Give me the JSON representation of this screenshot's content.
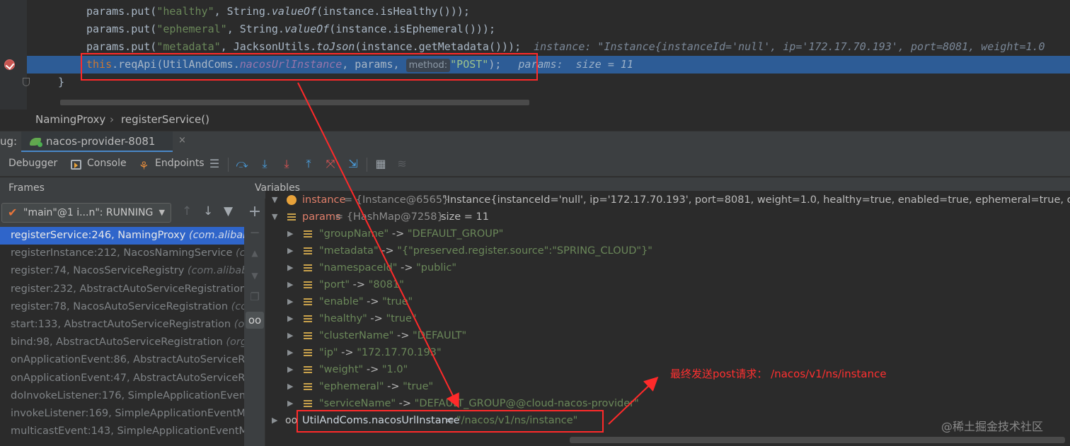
{
  "editor": {
    "lines": [
      {
        "a": "params.put(",
        "s": "\"healthy\"",
        "b": ", String.",
        "m": "valueOf",
        "c": "(instance.isHealthy()));"
      },
      {
        "a": "params.put(",
        "s": "\"ephemeral\"",
        "b": ", String.",
        "m": "valueOf",
        "c": "(instance.isEphemeral()));"
      },
      {
        "a": "params.put(",
        "s": "\"metadata\"",
        "b": ", JacksonUtils.",
        "m": "toJson",
        "c": "(instance.getMetadata()));",
        "inlay": "instance: \"Instance{instanceId='null', ip='172.17.70.193', port=8081, weight=1.0"
      }
    ],
    "current_line": {
      "kw": "this",
      "a": ".reqApi(UtilAndComs.",
      "field": "nacosUrlInstance",
      "b": ", params, ",
      "hint": "method:",
      "str": "\"POST\"",
      "end": ");",
      "inlay": "params:  size = 11"
    },
    "closing_brace": "}"
  },
  "breadcrumb": {
    "class_name": "NamingProxy",
    "separator": "›",
    "method_name": "registerService()"
  },
  "debug_tabbar": {
    "label": "ug:",
    "run_name": "nacos-provider-8081",
    "close": "×"
  },
  "toolbar": {
    "debugger": "Debugger",
    "console": "Console",
    "endpoints": "Endpoints"
  },
  "frames": {
    "header": "Frames",
    "thread": "\"main\"@1 i...n\": RUNNING",
    "items": [
      {
        "method": "registerService:246, NamingProxy ",
        "pkg": "(com.alibaba"
      },
      {
        "method": "registerInstance:212, NacosNamingService ",
        "pkg": "(co"
      },
      {
        "method": "register:74, NacosServiceRegistry ",
        "pkg": "(com.alibaba"
      },
      {
        "method": "register:232, AbstractAutoServiceRegistration",
        "pkg": ""
      },
      {
        "method": "register:78, NacosAutoServiceRegistration ",
        "pkg": "(co"
      },
      {
        "method": "start:133, AbstractAutoServiceRegistration ",
        "pkg": "(org"
      },
      {
        "method": "bind:98, AbstractAutoServiceRegistration ",
        "pkg": "(org."
      },
      {
        "method": "onApplicationEvent:86, AbstractAutoServiceRe",
        "pkg": ""
      },
      {
        "method": "onApplicationEvent:47, AbstractAutoServiceRe",
        "pkg": ""
      },
      {
        "method": "doInvokeListener:176, SimpleApplicationEventM",
        "pkg": ""
      },
      {
        "method": "invokeListener:169, SimpleApplicationEventMu",
        "pkg": ""
      },
      {
        "method": "multicastEvent:143, SimpleApplicationEventMu",
        "pkg": ""
      }
    ]
  },
  "variables": {
    "header": "Variables",
    "instance_row": {
      "name": "instance",
      "ref": " = {Instance@6565} ",
      "value": "\"Instance{instanceId='null', ip='172.17.70.193', port=8081, weight=1.0, healthy=true, enabled=true, ephemeral=true, clusterNa"
    },
    "params_row": {
      "name": "params",
      "ref": " = {HashMap@7258} ",
      "value": " size = 11"
    },
    "entries": [
      {
        "key": "\"groupName\"",
        "value": "\"DEFAULT_GROUP\""
      },
      {
        "key": "\"metadata\"",
        "value": "\"{\"preserved.register.source\":\"SPRING_CLOUD\"}\""
      },
      {
        "key": "\"namespaceId\"",
        "value": "\"public\""
      },
      {
        "key": "\"port\"",
        "value": "\"8081\""
      },
      {
        "key": "\"enable\"",
        "value": "\"true\""
      },
      {
        "key": "\"healthy\"",
        "value": "\"true\""
      },
      {
        "key": "\"clusterName\"",
        "value": "\"DEFAULT\""
      },
      {
        "key": "\"ip\"",
        "value": "\"172.17.70.193\""
      },
      {
        "key": "\"weight\"",
        "value": "\"1.0\""
      },
      {
        "key": "\"ephemeral\"",
        "value": "\"true\""
      },
      {
        "key": "\"serviceName\"",
        "value": "\"DEFAULT_GROUP@@cloud-nacos-provider\""
      }
    ],
    "arrow_sep": " -> ",
    "watch": {
      "name": "UtilAndComs.nacosUrlInstance",
      "eq": " = ",
      "value": "\"/nacos/v1/ns/instance\""
    }
  },
  "annotation": {
    "text": "最终发送post请求：  /nacos/v1/ns/instance"
  },
  "watermark": "@稀土掘金技术社区",
  "colors": {
    "annotation_red": "#ff2a2a",
    "selection_blue": "#2f65ca",
    "current_line": "#2d5c96"
  }
}
